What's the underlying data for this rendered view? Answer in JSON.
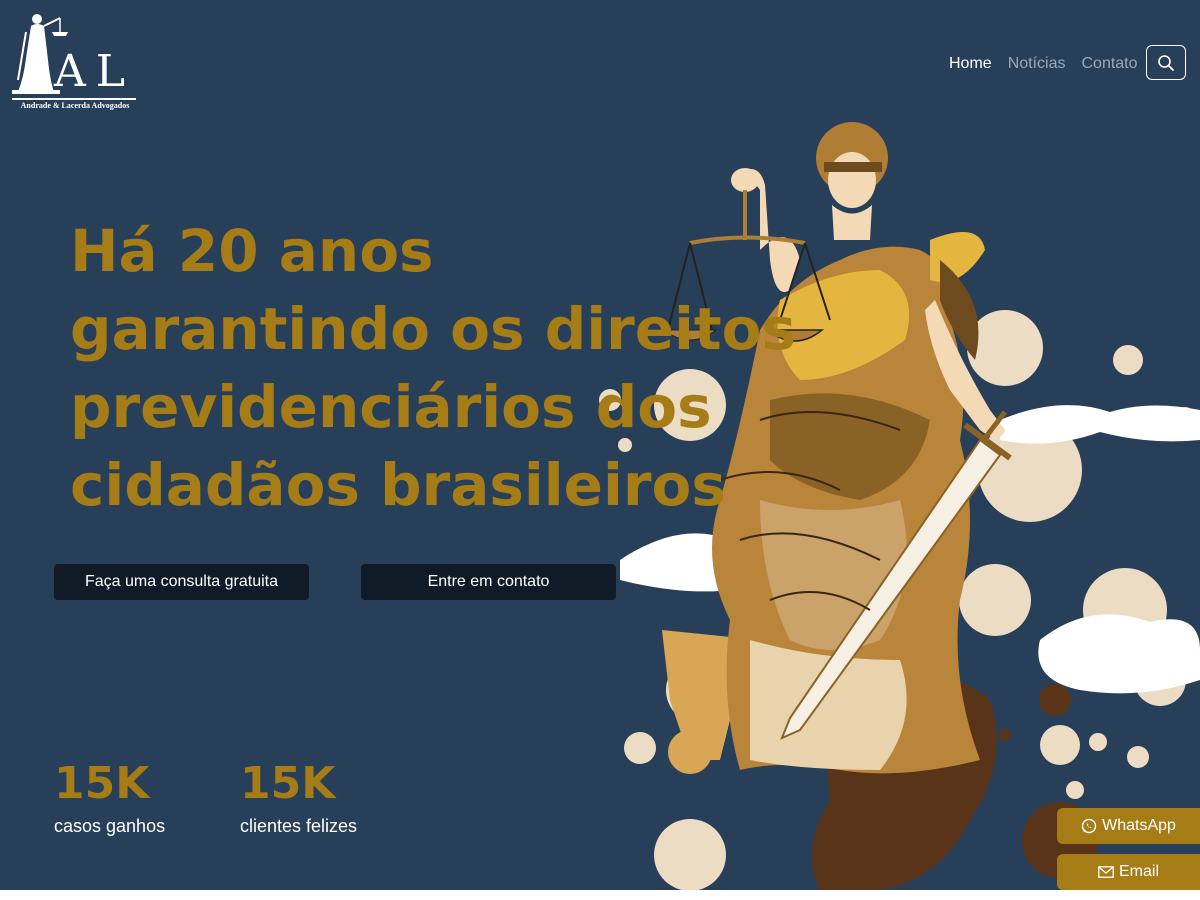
{
  "brand": {
    "monogram": "A L",
    "caption": "Andrade & Lacerda Advogados"
  },
  "nav": {
    "items": [
      {
        "label": "Home",
        "active": true
      },
      {
        "label": "Notícias",
        "active": false
      },
      {
        "label": "Contato",
        "active": false
      }
    ],
    "search_icon": "search-icon"
  },
  "hero": {
    "headline_lines": [
      "Há 20 anos",
      "garantindo os direitos",
      "previdenciários dos",
      "cidadãos brasileiros"
    ],
    "cta_primary": "Faça uma consulta gratuita",
    "cta_secondary": "Entre em contato"
  },
  "stats": [
    {
      "value": "15K",
      "label": "casos ganhos"
    },
    {
      "value": "15K",
      "label": "clientes felizes"
    }
  ],
  "floating_contact": {
    "whatsapp_label": "WhatsApp",
    "whatsapp_icon": "whatsapp-icon",
    "email_label": "Email",
    "email_icon": "envelope-icon"
  },
  "colors": {
    "background": "#283f5a",
    "accent_gold": "#a57c16",
    "button_dark": "#111b28",
    "text_light": "#ffffff",
    "nav_muted": "#9aa8b7"
  }
}
